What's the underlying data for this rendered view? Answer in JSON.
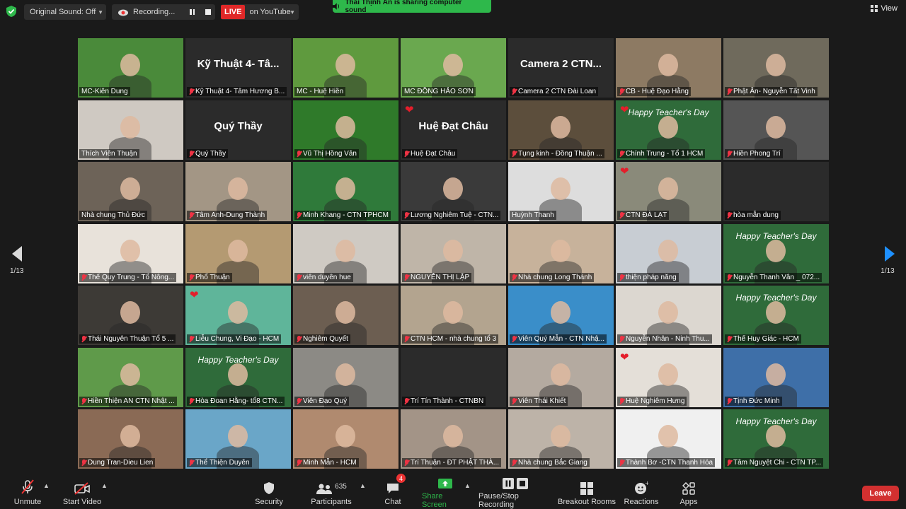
{
  "topbar": {
    "original_sound": "Original Sound: Off",
    "recording": "Recording...",
    "live": "LIVE",
    "on_youtube": "on YouTube",
    "sharing_banner": "Thái Thịnh Ân is sharing computer sound",
    "view": "View"
  },
  "pagination": {
    "left": "1/13",
    "right": "1/13"
  },
  "tiles": [
    {
      "name": "MC-Kiên Dung",
      "muted": false,
      "active": true,
      "bg": "#4a8a3a",
      "big": ""
    },
    {
      "name": "Kỹ Thuật 4- Tâm Hương B...",
      "muted": true,
      "bg": "#2b2b2b",
      "big": "Kỹ Thuật 4- Tâ..."
    },
    {
      "name": "MC - Huệ Hiền",
      "muted": false,
      "bg": "#5f9a3e",
      "big": ""
    },
    {
      "name": "MC ĐỒNG HẢO SƠN",
      "muted": false,
      "bg": "#6aa84f",
      "big": ""
    },
    {
      "name": "Camera 2 CTN Đài Loan",
      "muted": true,
      "bg": "#2b2b2b",
      "big": "Camera 2 CTN..."
    },
    {
      "name": "CB - Huệ Đạo Hằng",
      "muted": true,
      "bg": "#8d7a63",
      "big": ""
    },
    {
      "name": "Phật Ân- Nguyễn Tất Vinh",
      "muted": true,
      "bg": "#6f6a5c",
      "big": ""
    },
    {
      "name": "Thích Viên Thuận",
      "muted": false,
      "bg": "#cfc9c2",
      "big": ""
    },
    {
      "name": "Quý Thầy",
      "muted": true,
      "bg": "#2b2b2b",
      "big": "Quý Thầy"
    },
    {
      "name": "Vũ Thị Hồng Vân",
      "muted": true,
      "bg": "#2f7a2a",
      "big": ""
    },
    {
      "name": "Huệ Đạt Châu",
      "muted": true,
      "bg": "#2b2b2b",
      "big": "Huệ Đạt Châu",
      "heart": true
    },
    {
      "name": "Tụng kinh - Đồng Thuận ...",
      "muted": true,
      "bg": "#5c4e3c",
      "big": ""
    },
    {
      "name": "Chính Trung - Tổ 1 HCM",
      "muted": true,
      "bg": "#2f6b3a",
      "big": "",
      "heart": true,
      "ttd": "Happy Teacher's Day"
    },
    {
      "name": "Hiền Phong Trí",
      "muted": true,
      "bg": "#555",
      "big": ""
    },
    {
      "name": "Nhà chung Thủ Đức",
      "muted": false,
      "bg": "#6d6358",
      "big": ""
    },
    {
      "name": "Tâm Anh-Dung Thành",
      "muted": true,
      "bg": "#a39685",
      "big": ""
    },
    {
      "name": "Minh Khang - CTN TPHCM",
      "muted": true,
      "bg": "#2f7a3a",
      "big": ""
    },
    {
      "name": "Lương Nghiêm Tuệ - CTN...",
      "muted": true,
      "bg": "#3a3a3a",
      "big": ""
    },
    {
      "name": "Huỳnh Thanh",
      "muted": false,
      "bg": "#ddd",
      "big": ""
    },
    {
      "name": "CTN ĐÀ LẠT",
      "muted": true,
      "bg": "#8a8a7a",
      "big": "",
      "heart": true
    },
    {
      "name": "hòa mẫn dung",
      "muted": true,
      "bg": "#2b2b2b",
      "big": ""
    },
    {
      "name": "Thế Quy Trung - Tổ Nông...",
      "muted": true,
      "bg": "#e8e2da",
      "big": ""
    },
    {
      "name": "Phổ Thuận",
      "muted": true,
      "bg": "#b49a72",
      "big": ""
    },
    {
      "name": "viên duyên hue",
      "muted": true,
      "bg": "#cfcac3",
      "big": ""
    },
    {
      "name": "NGUYỄN THỊ LẬP",
      "muted": true,
      "bg": "#bfb5a8",
      "big": ""
    },
    {
      "name": "Nhà chung Long Thành",
      "muted": true,
      "bg": "#c7b29b",
      "big": ""
    },
    {
      "name": "thiện pháp năng",
      "muted": true,
      "bg": "#c8cdd3",
      "big": ""
    },
    {
      "name": "Nguyễn Thanh Vân _ 072...",
      "muted": true,
      "bg": "#2f6b3a",
      "big": "",
      "ttd": "Happy Teacher's Day"
    },
    {
      "name": "Thái Nguyên Thuận Tổ 5 ...",
      "muted": true,
      "bg": "#3d3a36",
      "big": ""
    },
    {
      "name": "Liễu Chung, Vi Đạo - HCM",
      "muted": true,
      "bg": "#5fb59a",
      "big": "",
      "heart": true
    },
    {
      "name": "Nghiêm Quyết",
      "muted": true,
      "bg": "#6c5e51",
      "big": ""
    },
    {
      "name": "CTN HCM - nhà chung tổ 3",
      "muted": true,
      "bg": "#b3a48f",
      "big": ""
    },
    {
      "name": "Viên Quý Mẫn - CTN Nhậ...",
      "muted": true,
      "bg": "#3a8ec9",
      "big": ""
    },
    {
      "name": "Nguyễn Nhân - Ninh Thu...",
      "muted": true,
      "bg": "#dcd7d0",
      "big": ""
    },
    {
      "name": "Thế Huy Giác - HCM",
      "muted": true,
      "bg": "#2f6b3a",
      "big": "",
      "ttd": "Happy Teacher's Day"
    },
    {
      "name": "Hiền Thiện AN CTN Nhật ...",
      "muted": true,
      "bg": "#5f9a4a",
      "big": ""
    },
    {
      "name": "Hòa Đoan Hằng- tổ8 CTN...",
      "muted": true,
      "bg": "#2f6b3a",
      "big": "",
      "ttd": "Happy Teacher's Day"
    },
    {
      "name": "Viên Đạo Quý",
      "muted": true,
      "bg": "#8c8a85",
      "big": ""
    },
    {
      "name": "Trí Tín Thành - CTNBN",
      "muted": true,
      "bg": "#2b2b2b",
      "big": ""
    },
    {
      "name": "Viên Thái Khiết",
      "muted": true,
      "bg": "#b4aaa0",
      "big": ""
    },
    {
      "name": "Huệ Nghiêm Hưng",
      "muted": true,
      "bg": "#e4dfd8",
      "big": "",
      "heart": true
    },
    {
      "name": "Tịnh Đức Minh",
      "muted": true,
      "bg": "#3e6fa8",
      "big": ""
    },
    {
      "name": "Dung Tran-Dieu Lien",
      "muted": true,
      "bg": "#8a6a55",
      "big": ""
    },
    {
      "name": "Thể Thiện Duyên",
      "muted": true,
      "bg": "#6aa6c8",
      "big": ""
    },
    {
      "name": "Minh Mẫn - HCM",
      "muted": true,
      "bg": "#b08a6f",
      "big": ""
    },
    {
      "name": "Trí Thuận - ĐT PHẬT THÀ...",
      "muted": true,
      "bg": "#a39487",
      "big": ""
    },
    {
      "name": "Nhà chung Bắc Giang",
      "muted": true,
      "bg": "#bdb3a8",
      "big": ""
    },
    {
      "name": "Thành Bơ -CTN Thanh Hóa",
      "muted": true,
      "bg": "#f0f0f0",
      "big": ""
    },
    {
      "name": "Tâm Nguyệt Chi - CTN TP...",
      "muted": true,
      "bg": "#2f6b3a",
      "big": "",
      "ttd": "Happy Teacher's Day"
    }
  ],
  "toolbar": {
    "unmute": "Unmute",
    "start_video": "Start Video",
    "security": "Security",
    "participants": "Participants",
    "participants_count": "635",
    "chat": "Chat",
    "chat_badge": "4",
    "share_screen": "Share Screen",
    "pause_stop_recording": "Pause/Stop Recording",
    "breakout_rooms": "Breakout Rooms",
    "reactions": "Reactions",
    "apps": "Apps",
    "leave": "Leave"
  },
  "colors": {
    "accent_green": "#2eb84b",
    "live_red": "#e02828",
    "leave_red": "#d23030",
    "active_speaker": "#d9e24e",
    "nav_blue": "#1e90ff"
  }
}
